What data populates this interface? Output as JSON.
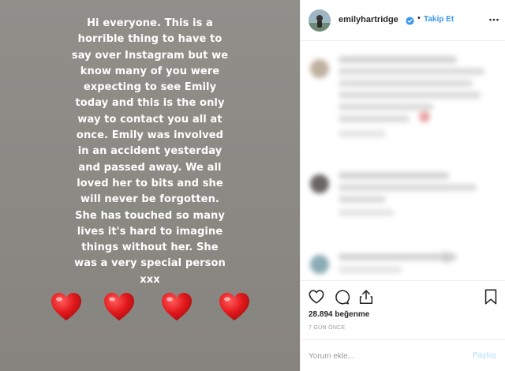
{
  "story": {
    "lines": [
      "Hi everyone. This is a",
      "horrible thing to have to",
      "say over Instagram but we",
      "know many of you were",
      "expecting to see Emily",
      "today and this is the only",
      "way to contact you all at",
      "once. Emily was involved",
      "in an accident yesterday",
      "and passed away. We all",
      "loved her to bits and she",
      "will never be forgotten.",
      "She has touched so many",
      "lives it's hard to imagine",
      "things without her. She",
      "was a very special person",
      "xxx"
    ],
    "heart_icon": "red-heart-emoji",
    "heart_color": "#e3191c"
  },
  "post": {
    "username": "emilyhartridge",
    "verified_icon": "verified-badge-icon",
    "separator": "•",
    "follow_label": "Takip Et",
    "accent_color": "#3897f0",
    "likes": "28.894 beğenme",
    "time_ago": "7 GÜN ÖNCE",
    "comment_placeholder": "Yorum ekle...",
    "post_label": "Paylaş"
  }
}
